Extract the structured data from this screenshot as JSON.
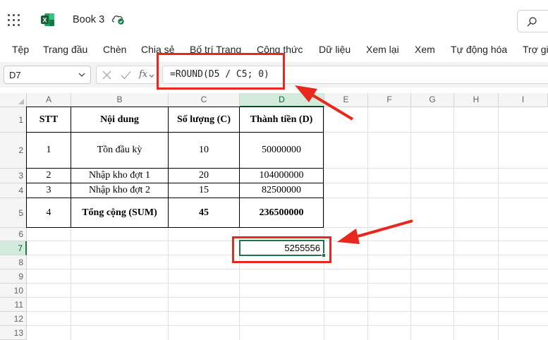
{
  "titlebar": {
    "doc_title": "Book 3",
    "app_icon": "excel-icon",
    "sync_icon": "cloud-saved-icon",
    "search_icon": "search-icon"
  },
  "ribbon": {
    "tabs": [
      "Tệp",
      "Trang đầu",
      "Chèn",
      "Chia sẻ",
      "Bố trí Trang",
      "Công thức",
      "Dữ liệu",
      "Xem lại",
      "Xem",
      "Tự động hóa",
      "Trợ giúp"
    ]
  },
  "formula_bar": {
    "name_box": "D7",
    "fx_label": "fx",
    "formula": "=ROUND(D5 / C5; 0)"
  },
  "columns": [
    "A",
    "B",
    "C",
    "D",
    "E",
    "F",
    "G",
    "H",
    "I"
  ],
  "selected_column": "D",
  "rows": [
    "1",
    "2",
    "3",
    "4",
    "5",
    "6",
    "7",
    "8",
    "9",
    "10",
    "11",
    "12",
    "13"
  ],
  "selected_row": "7",
  "table": {
    "header": [
      "STT",
      "Nội dung",
      "Số lượng (C)",
      "Thành tiền (D)"
    ],
    "body": [
      [
        "1",
        "Tồn đầu kỳ",
        "10",
        "50000000"
      ],
      [
        "2",
        "Nhập kho đợt 1",
        "20",
        "104000000"
      ],
      [
        "3",
        "Nhập kho đợt 2",
        "15",
        "82500000"
      ],
      [
        "4",
        "Tổng cộng (SUM)",
        "45",
        "236500000"
      ]
    ]
  },
  "active_cell": {
    "address": "D7",
    "value": "5255556"
  },
  "colors": {
    "excel_green": "#217346",
    "annotation_red": "#e8271d",
    "header_selected_bg": "#d3ebdc"
  }
}
